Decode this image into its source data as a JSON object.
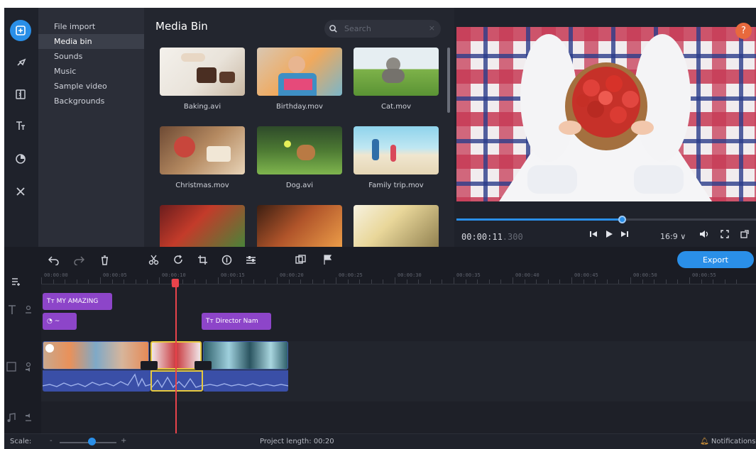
{
  "colors": {
    "accent": "#2a8fe8",
    "text_clip": "#8d45c9",
    "playhead": "#e8434b",
    "help": "#e8693d"
  },
  "rail": {
    "icons": [
      "import-icon",
      "pin-icon",
      "transition-icon",
      "titles-icon",
      "filters-icon",
      "tools-icon"
    ]
  },
  "subnav": {
    "items": [
      {
        "label": "File import",
        "active": false
      },
      {
        "label": "Media bin",
        "active": true
      },
      {
        "label": "Sounds",
        "active": false
      },
      {
        "label": "Music",
        "active": false
      },
      {
        "label": "Sample video",
        "active": false
      },
      {
        "label": "Backgrounds",
        "active": false
      }
    ]
  },
  "bin": {
    "title": "Media Bin",
    "search_placeholder": "Search",
    "clear_glyph": "×",
    "files": [
      {
        "name": "Baking.avi"
      },
      {
        "name": "Birthday.mov"
      },
      {
        "name": "Cat.mov"
      },
      {
        "name": "Christmas.mov"
      },
      {
        "name": "Dog.avi"
      },
      {
        "name": "Family trip.mov"
      },
      {
        "name": ""
      },
      {
        "name": ""
      },
      {
        "name": ""
      }
    ]
  },
  "preview": {
    "help": "?",
    "timecode": "00:00:11",
    "timecode_ms": ".300",
    "progress": 0.55,
    "ratio": "16:9 ∨"
  },
  "timeline": {
    "export_label": "Export",
    "ruler": [
      "00:00:00",
      "00:00:05",
      "00:00:10",
      "00:00:15",
      "00:00:20",
      "00:00:25",
      "00:00:30",
      "00:00:35",
      "00:00:40",
      "00:00:45",
      "00:00:50",
      "00:00:55"
    ],
    "clips": {
      "title1": "MY AMAZING",
      "title2": "Director Nam",
      "sticker": "~"
    }
  },
  "status": {
    "scale_label": "Scale:",
    "project_length": "Project length: 00:20",
    "notifications": "Notifications"
  }
}
